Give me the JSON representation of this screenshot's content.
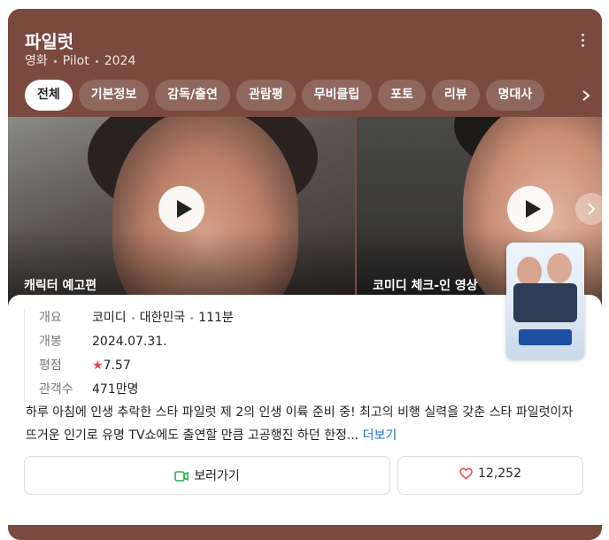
{
  "header": {
    "title": "파일럿",
    "meta": [
      "영화",
      "Pilot",
      "2024"
    ]
  },
  "tabs": [
    {
      "label": "전체",
      "active": true
    },
    {
      "label": "기본정보",
      "active": false
    },
    {
      "label": "감독/출연",
      "active": false
    },
    {
      "label": "관람평",
      "active": false
    },
    {
      "label": "무비클립",
      "active": false
    },
    {
      "label": "포토",
      "active": false
    },
    {
      "label": "리뷰",
      "active": false
    },
    {
      "label": "명대사",
      "active": false
    }
  ],
  "clips": [
    {
      "label": "캐릭터 예고편"
    },
    {
      "label": "코미디 체크-인 영상"
    }
  ],
  "info": {
    "rows": [
      {
        "key": "개요",
        "values": [
          "코미디",
          "대한민국",
          "111분"
        ]
      },
      {
        "key": "개봉",
        "values": [
          "2024.07.31."
        ]
      },
      {
        "key": "평점",
        "star": "★",
        "values": [
          "7.57"
        ]
      },
      {
        "key": "관객수",
        "values": [
          "471만명"
        ]
      }
    ],
    "synopsis": "하루 아침에 인생 추락한 스타 파일럿 제 2의 인생 이륙 준비 중! 최고의 비행 실력을 갖춘 스타 파일럿이자 뜨거운 인기로 유명 TV쇼에도 출연할 만큼 고공행진 하던 한정...",
    "more_label": "더보기",
    "watch_label": "보러가기",
    "like_count": "12,252"
  },
  "colors": {
    "header_bg": "#7b4a3f",
    "accent_link": "#1a6fd1",
    "star": "#e5484d",
    "watch_icon": "#22b14c"
  }
}
